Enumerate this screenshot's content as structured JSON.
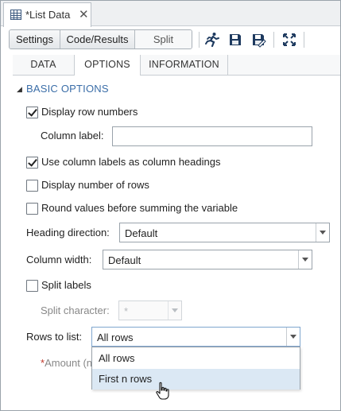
{
  "window": {
    "tab_title": "*List Data",
    "tab_icon": "table-icon",
    "close_icon": "close-icon",
    "close_glyph": "✕"
  },
  "toolbar": {
    "view_buttons": [
      "Settings",
      "Code/Results",
      "Split"
    ],
    "icons": [
      "run-icon",
      "save-icon",
      "save-as-icon",
      "maximize-icon"
    ]
  },
  "tabs": [
    "DATA",
    "OPTIONS",
    "INFORMATION"
  ],
  "section": {
    "title": "BASIC OPTIONS",
    "toggle_glyph": "◢"
  },
  "options": {
    "display_row_numbers": {
      "label": "Display row numbers",
      "checked": true
    },
    "column_label": {
      "label": "Column label:",
      "value": ""
    },
    "use_column_labels": {
      "label": "Use column labels as column headings",
      "checked": true
    },
    "display_number_of_rows": {
      "label": "Display number of rows",
      "checked": false
    },
    "round_values": {
      "label": "Round values before summing the variable",
      "checked": false
    },
    "heading_direction": {
      "label": "Heading direction:",
      "value": "Default"
    },
    "column_width": {
      "label": "Column width:",
      "value": "Default"
    },
    "split_labels": {
      "label": "Split labels",
      "checked": false
    },
    "split_character": {
      "label": "Split character:",
      "value": "*"
    },
    "rows_to_list": {
      "label": "Rows to list:",
      "value": "All rows",
      "options": [
        "All rows",
        "First n rows"
      ],
      "highlighted": "First n rows"
    },
    "amount": {
      "required_mark": "*",
      "label": "Amount (n"
    }
  },
  "colors": {
    "accent": "#3b6ea8",
    "highlight": "#dbe8f4",
    "required": "#c0392b"
  }
}
